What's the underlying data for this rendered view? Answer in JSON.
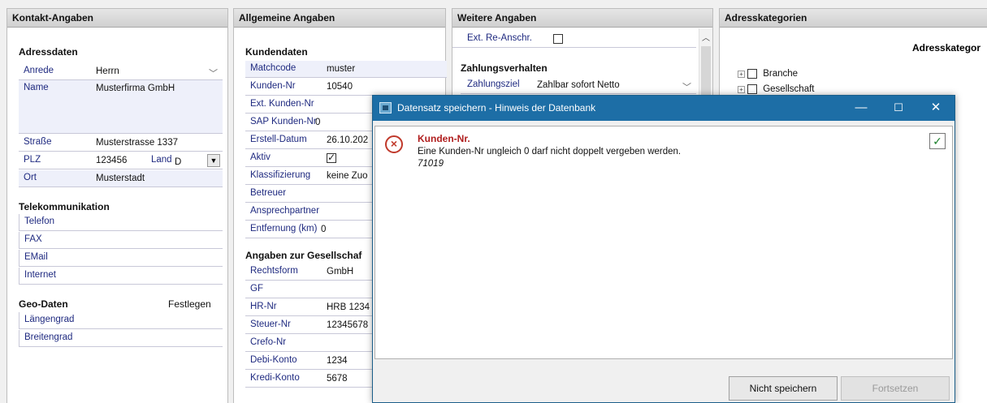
{
  "kontakt": {
    "header": "Kontakt-Angaben",
    "adressdaten_title": "Adressdaten",
    "anrede_label": "Anrede",
    "anrede_value": "Herrn",
    "name_label": "Name",
    "name_value": "Musterfirma GmbH",
    "strasse_label": "Straße",
    "strasse_value": "Musterstrasse 1337",
    "plz_label": "PLZ",
    "plz_value": "123456",
    "land_label": "Land",
    "land_value": "D",
    "ort_label": "Ort",
    "ort_value": "Musterstadt",
    "telekom_title": "Telekommunikation",
    "telefon_label": "Telefon",
    "fax_label": "FAX",
    "email_label": "EMail",
    "internet_label": "Internet",
    "geo_title": "Geo-Daten",
    "festlegen_label": "Festlegen",
    "laengengrad_label": "Längengrad",
    "breitengrad_label": "Breitengrad"
  },
  "allgemein": {
    "header": "Allgemeine Angaben",
    "kundendaten_title": "Kundendaten",
    "matchcode_label": "Matchcode",
    "matchcode_value": "muster",
    "kundennr_label": "Kunden-Nr",
    "kundennr_value": "10540",
    "ext_kundennr_label": "Ext. Kunden-Nr",
    "sap_label": "SAP Kunden-Nr",
    "sap_value": "0",
    "erstell_label": "Erstell-Datum",
    "erstell_value": "26.10.202",
    "aktiv_label": "Aktiv",
    "aktiv_checked": true,
    "klass_label": "Klassifizierung",
    "klass_value": "keine Zuo",
    "betreuer_label": "Betreuer",
    "ansprech_label": "Ansprechpartner",
    "entfernung_label": "Entfernung (km)",
    "entfernung_value": "0",
    "gesellschaft_title": "Angaben zur Gesellschaf",
    "rechtsform_label": "Rechtsform",
    "rechtsform_value": "GmbH",
    "gf_label": "GF",
    "hrnr_label": "HR-Nr",
    "hrnr_value": "HRB 1234",
    "steuer_label": "Steuer-Nr",
    "steuer_value": "12345678",
    "crefo_label": "Crefo-Nr",
    "debi_label": "Debi-Konto",
    "debi_value": "1234",
    "kredi_label": "Kredi-Konto",
    "kredi_value": "5678"
  },
  "weitere": {
    "header": "Weitere Angaben",
    "ext_re_label": "Ext. Re-Anschr.",
    "zahlungsverhalten_title": "Zahlungsverhalten",
    "zahlungsziel_label": "Zahlungsziel",
    "zahlungsziel_value": "Zahlbar sofort Netto"
  },
  "adresskat": {
    "header": "Adresskategorien",
    "column_title": "Adresskategor",
    "items": [
      "Branche",
      "Gesellschaft"
    ]
  },
  "dialog": {
    "title": "Datensatz speichern - Hinweis der Datenbank",
    "error_title": "Kunden-Nr.",
    "error_message": "Eine Kunden-Nr ungleich 0 darf nicht doppelt vergeben werden.",
    "error_code": "71019",
    "btn_nicht_speichern": "Nicht speichern",
    "btn_fortsetzen": "Fortsetzen"
  }
}
